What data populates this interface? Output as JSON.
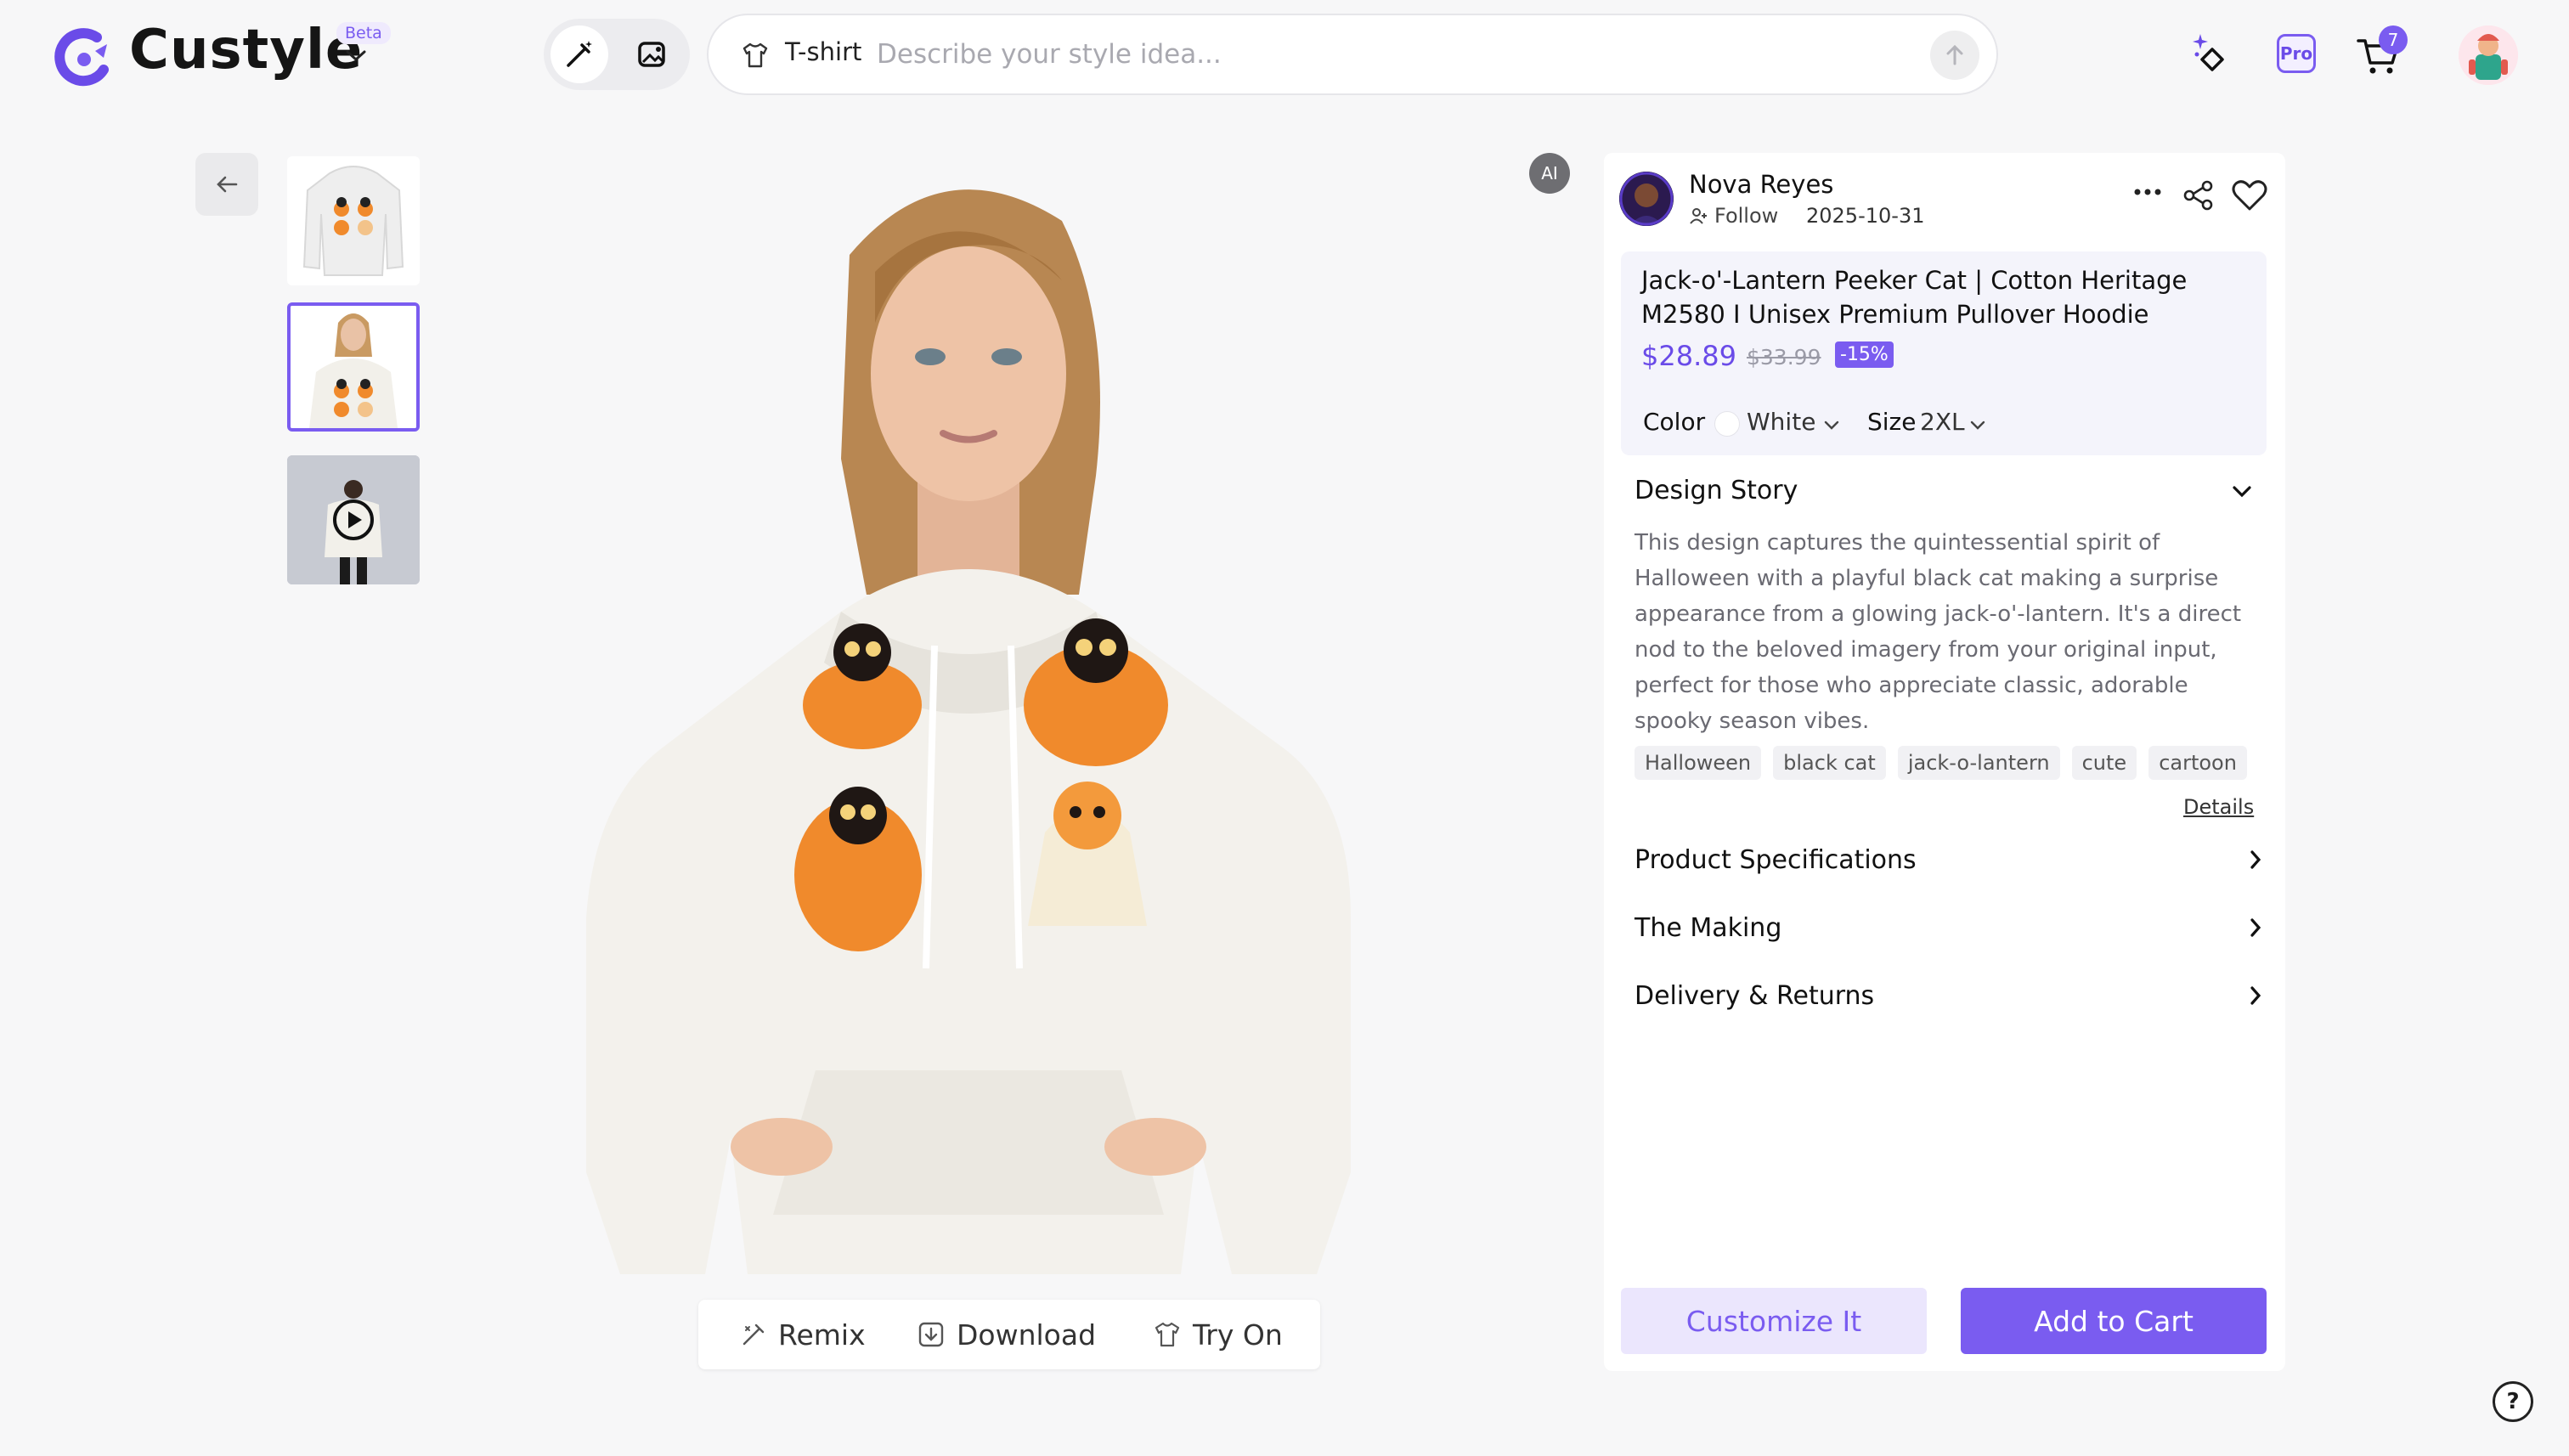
{
  "brand": {
    "name": "Custyle",
    "badge": "Beta",
    "colors": {
      "accent": "#7a5cf0",
      "accent_light": "#ebe6fd"
    }
  },
  "header": {
    "tools": [
      "edit-wand-icon",
      "image-edit-icon"
    ],
    "search": {
      "category": "T-shirt",
      "placeholder": "Describe your style idea..."
    },
    "pro_label": "Pro",
    "cart_count": "7"
  },
  "gallery": {
    "thumbnails": [
      {
        "name": "hoodie-flat-view",
        "selected": false
      },
      {
        "name": "model-wearing-hoodie",
        "selected": true
      },
      {
        "name": "video-preview",
        "selected": false
      }
    ],
    "ai_badge": "AI"
  },
  "actions": {
    "remix": "Remix",
    "download": "Download",
    "try_on": "Try On"
  },
  "creator": {
    "name": "Nova Reyes",
    "follow": "Follow",
    "date": "2025-10-31"
  },
  "product": {
    "title": "Jack-o'-Lantern Peeker Cat | Cotton Heritage M2580 I Unisex Premium Pullover Hoodie",
    "price": "$28.89",
    "old_price": "$33.99",
    "discount": "-15%",
    "color_label": "Color",
    "color_value": "White",
    "size_label": "Size",
    "size_value": "2XL"
  },
  "design_story": {
    "title": "Design Story",
    "text": "This design captures the quintessential spirit of Halloween with a playful black cat making a surprise appearance from a glowing jack-o'-lantern. It's a direct nod to the beloved imagery from your original input, perfect for those who appreciate classic, adorable spooky season vibes.",
    "tags": [
      "Halloween",
      "black cat",
      "jack-o-lantern",
      "cute",
      "cartoon"
    ],
    "details_link": "Details"
  },
  "sections": {
    "specs": "Product Specifications",
    "making": "The Making",
    "delivery": "Delivery & Returns"
  },
  "buttons": {
    "customize": "Customize It",
    "add_to_cart": "Add to Cart"
  },
  "help": "?"
}
